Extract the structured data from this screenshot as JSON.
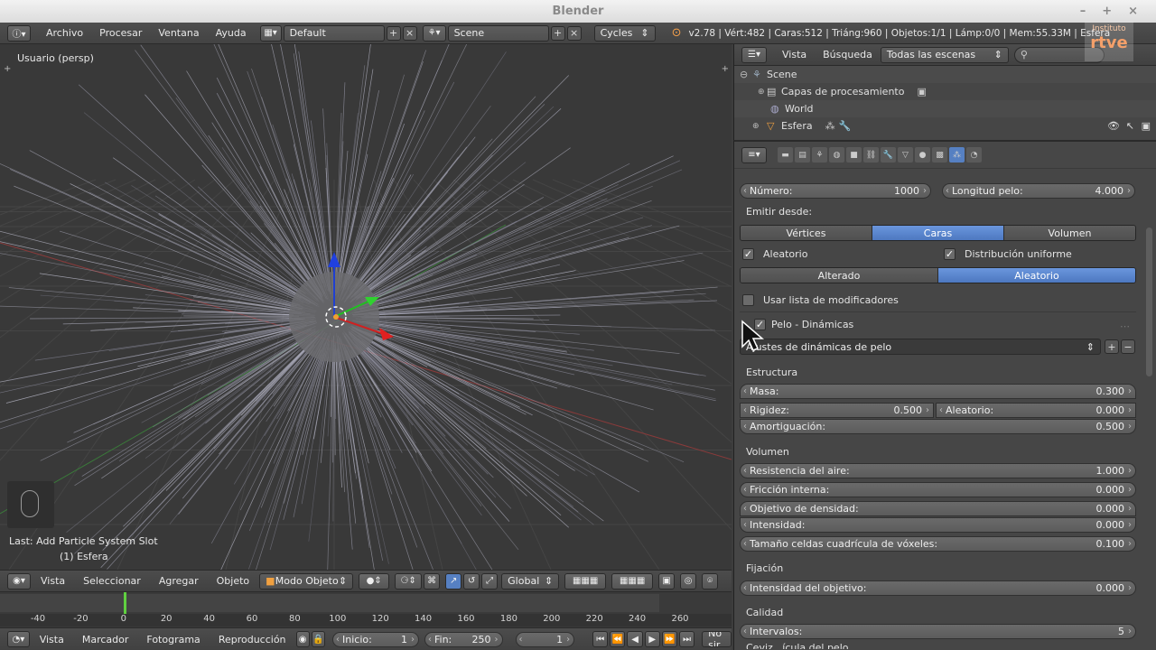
{
  "window": {
    "title": "Blender",
    "controls": [
      "–",
      "+",
      "×"
    ],
    "watermark_line1": "Instituto",
    "watermark_line2": "rtve"
  },
  "info_header": {
    "menus": [
      "Archivo",
      "Procesar",
      "Ventana",
      "Ayuda"
    ],
    "screen_layout": "Default",
    "scene": "Scene",
    "engine": "Cycles",
    "stats": "v2.78 | Vért:482 | Caras:512 | Triáng:960 | Objetos:1/1 | Lámp:0/0 | Mem:55.33M | Esfera"
  },
  "viewport": {
    "view_label": "Usuario (persp)",
    "last_operation": "Last: Add Particle System Slot",
    "object_label": "(1) Esfera",
    "header": {
      "menus": [
        "Vista",
        "Seleccionar",
        "Agregar",
        "Objeto"
      ],
      "mode": "Modo Objeto",
      "orientation": "Global"
    }
  },
  "timeline": {
    "frame_numbers": [
      "-40",
      "-20",
      "0",
      "20",
      "40",
      "60",
      "80",
      "100",
      "120",
      "140",
      "160",
      "180",
      "200",
      "220",
      "240",
      "260"
    ],
    "current_frame": 1,
    "header": {
      "menus": [
        "Vista",
        "Marcador",
        "Fotograma",
        "Reproducción"
      ],
      "start_label": "Inicio:",
      "start_value": "1",
      "end_label": "Fin:",
      "end_value": "250",
      "current_value": "1",
      "sync": "No sir"
    }
  },
  "outliner": {
    "menus": [
      "Vista",
      "Búsqueda"
    ],
    "filter": "Todas las escenas",
    "search_placeholder": "",
    "tree": [
      {
        "label": "Scene",
        "indent": 0
      },
      {
        "label": "Capas de procesamiento",
        "indent": 1
      },
      {
        "label": "World",
        "indent": 1
      },
      {
        "label": "Esfera",
        "indent": 1
      }
    ]
  },
  "properties": {
    "numero_label": "Número:",
    "numero_value": "1000",
    "longitud_label": "Longitud pelo:",
    "longitud_value": "4.000",
    "emitir_label": "Emitir desde:",
    "emit_options": [
      "Vértices",
      "Caras",
      "Volumen"
    ],
    "emit_selected": 1,
    "aleatorio_label": "Aleatorio",
    "distribucion_label": "Distribución uniforme",
    "order_options": [
      "Alterado",
      "Aleatorio"
    ],
    "order_selected": 1,
    "modifier_stack_label": "Usar lista de modificadores",
    "hair_dynamics_label": "Pelo - Dinámicas",
    "presets_label": "Ajustes de dinámicas de pelo",
    "estructura_label": "Estructura",
    "masa_label": "Masa:",
    "masa_value": "0.300",
    "rigidez_label": "Rigidez:",
    "rigidez_value": "0.500",
    "aleatorio_field_label": "Aleatorio:",
    "aleatorio_field_value": "0.000",
    "amortiguacion_label": "Amortiguación:",
    "amortiguacion_value": "0.500",
    "volumen_label": "Volumen",
    "resistencia_label": "Resistencia del aire:",
    "resistencia_value": "1.000",
    "friccion_label": "Fricción interna:",
    "friccion_value": "0.000",
    "densidad_label": "Objetivo de densidad:",
    "densidad_value": "0.000",
    "intensidad_label": "Intensidad:",
    "intensidad_value": "0.000",
    "voxel_label": "Tamaño celdas cuadrícula de vóxeles:",
    "voxel_value": "0.100",
    "fijacion_label": "Fijación",
    "intensidad_obj_label": "Intensidad del objetivo:",
    "intensidad_obj_value": "0.000",
    "calidad_label": "Calidad",
    "intervalos_label": "Intervalos:",
    "intervalos_value": "5",
    "cut_label": "Ceviz...ícula del pelo"
  }
}
